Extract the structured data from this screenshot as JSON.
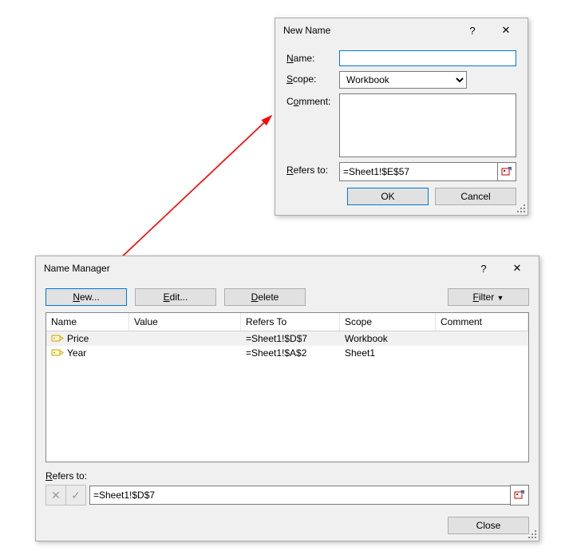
{
  "newName": {
    "title": "New Name",
    "labels": {
      "name": "Name:",
      "scope": "Scope:",
      "comment": "Comment:",
      "refers": "Refers to:"
    },
    "nameValue": "",
    "scopeValue": "Workbook",
    "commentValue": "",
    "refersValue": "=Sheet1!$E$57",
    "ok": "OK",
    "cancel": "Cancel"
  },
  "nameManager": {
    "title": "Name Manager",
    "buttons": {
      "new": "New...",
      "edit": "Edit...",
      "delete": "Delete",
      "filter": "Filter",
      "close": "Close"
    },
    "columns": {
      "name": "Name",
      "value": "Value",
      "refers": "Refers To",
      "scope": "Scope",
      "comment": "Comment"
    },
    "rows": [
      {
        "name": "Price",
        "value": "",
        "refers": "=Sheet1!$D$7",
        "scope": "Workbook",
        "comment": "",
        "selected": true
      },
      {
        "name": "Year",
        "value": "",
        "refers": "=Sheet1!$A$2",
        "scope": "Sheet1",
        "comment": "",
        "selected": false
      }
    ],
    "refersLabel": "Refers to:",
    "refersValue": "=Sheet1!$D$7"
  }
}
